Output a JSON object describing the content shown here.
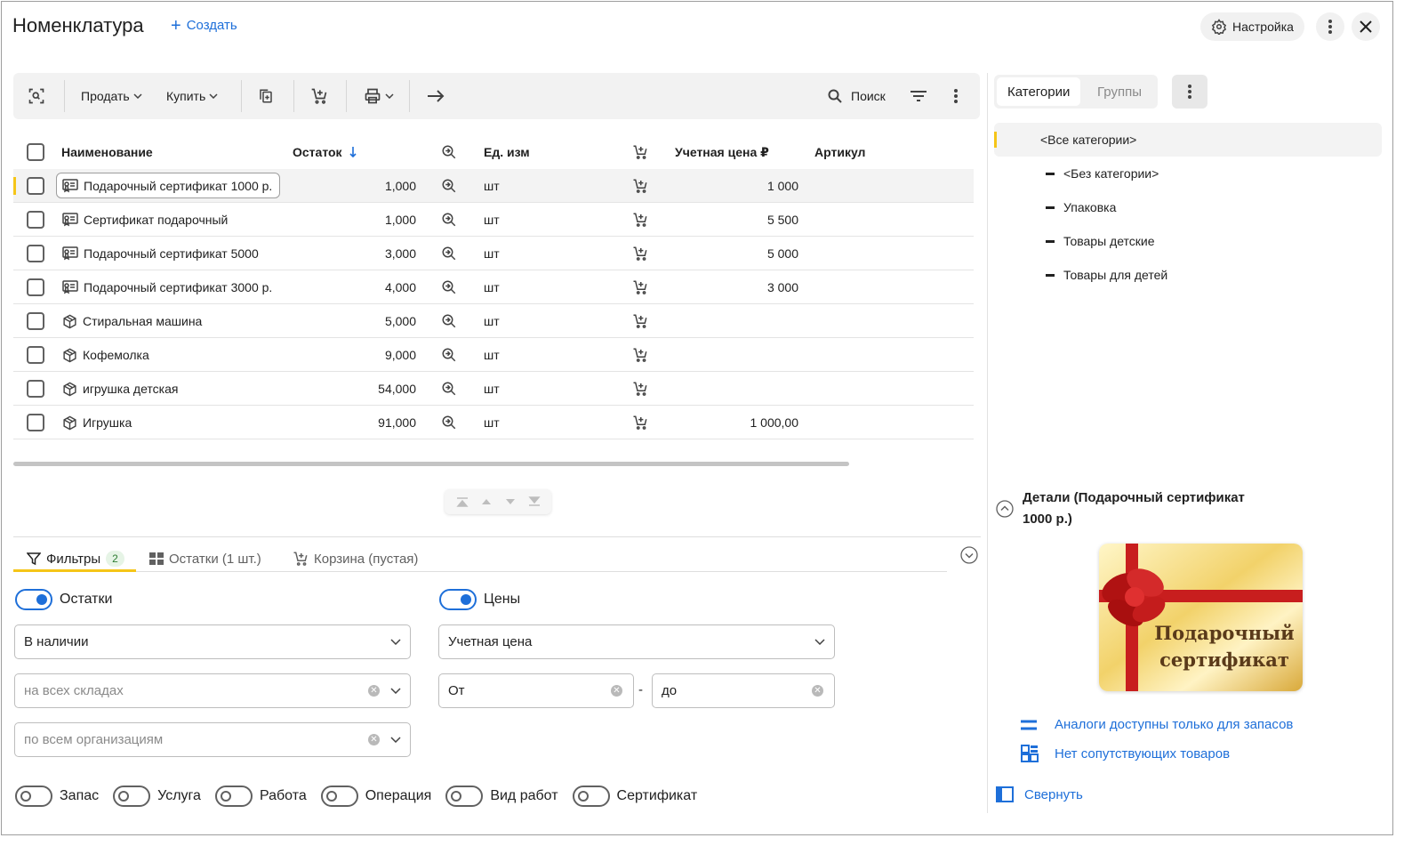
{
  "header": {
    "title": "Номенклатура",
    "create_label": "Создать",
    "settings_label": "Настройка"
  },
  "toolbar": {
    "sell_label": "Продать",
    "buy_label": "Купить",
    "search_label": "Поиск"
  },
  "table": {
    "columns": {
      "name": "Наименование",
      "stock": "Остаток",
      "unit": "Ед. изм",
      "price": "Учетная цена ₽",
      "article": "Артикул"
    },
    "rows": [
      {
        "name": "Подарочный сертификат 1000 р.",
        "stock": "1,000",
        "unit": "шт",
        "price": "1 000",
        "icon": "certificate-icon"
      },
      {
        "name": "Сертификат подарочный",
        "stock": "1,000",
        "unit": "шт",
        "price": "5 500",
        "icon": "certificate-icon"
      },
      {
        "name": "Подарочный сертификат 5000",
        "stock": "3,000",
        "unit": "шт",
        "price": "5 000",
        "icon": "certificate-icon"
      },
      {
        "name": "Подарочный сертификат 3000 р.",
        "stock": "4,000",
        "unit": "шт",
        "price": "3 000",
        "icon": "certificate-icon"
      },
      {
        "name": "Стиральная машина",
        "stock": "5,000",
        "unit": "шт",
        "price": "",
        "icon": "box-icon"
      },
      {
        "name": "Кофемолка",
        "stock": "9,000",
        "unit": "шт",
        "price": "",
        "icon": "box-icon"
      },
      {
        "name": "игрушка детская",
        "stock": "54,000",
        "unit": "шт",
        "price": "",
        "icon": "box-icon"
      },
      {
        "name": "Игрушка",
        "stock": "91,000",
        "unit": "шт",
        "price": "1 000,00",
        "icon": "box-icon"
      }
    ]
  },
  "bottom_tabs": {
    "filters_label": "Фильтры",
    "filters_count": "2",
    "stock_label": "Остатки (1 шт.)",
    "cart_label": "Корзина (пустая)"
  },
  "filters": {
    "stock_toggle_label": "Остатки",
    "prices_toggle_label": "Цены",
    "stock_select_value": "В наличии",
    "price_select_value": "Учетная цена",
    "warehouses_placeholder": "на всех складах",
    "orgs_placeholder": "по всем организациям",
    "price_from_value": "От",
    "price_range_sep": "-",
    "price_to_value": "до",
    "type_toggles": [
      "Запас",
      "Услуга",
      "Работа",
      "Операция",
      "Вид работ",
      "Сертификат"
    ]
  },
  "right_panel": {
    "tab_categories": "Категории",
    "tab_groups": "Группы",
    "all_categories": "<Все категории>",
    "categories": [
      "<Без категории>",
      "Упаковка",
      "Товары детские",
      "Товары для детей"
    ],
    "details_title": "Детали (Подарочный сертификат 1000 р.)",
    "cert_image_text_line1": "Подарочный",
    "cert_image_text_line2": "сертификат",
    "analogs_link": "Аналоги доступны только для запасов",
    "related_link": "Нет сопутствующих товаров",
    "collapse_link": "Свернуть"
  },
  "colors": {
    "accent_blue": "#1e6fd9",
    "selection_yellow": "#f5c518"
  }
}
